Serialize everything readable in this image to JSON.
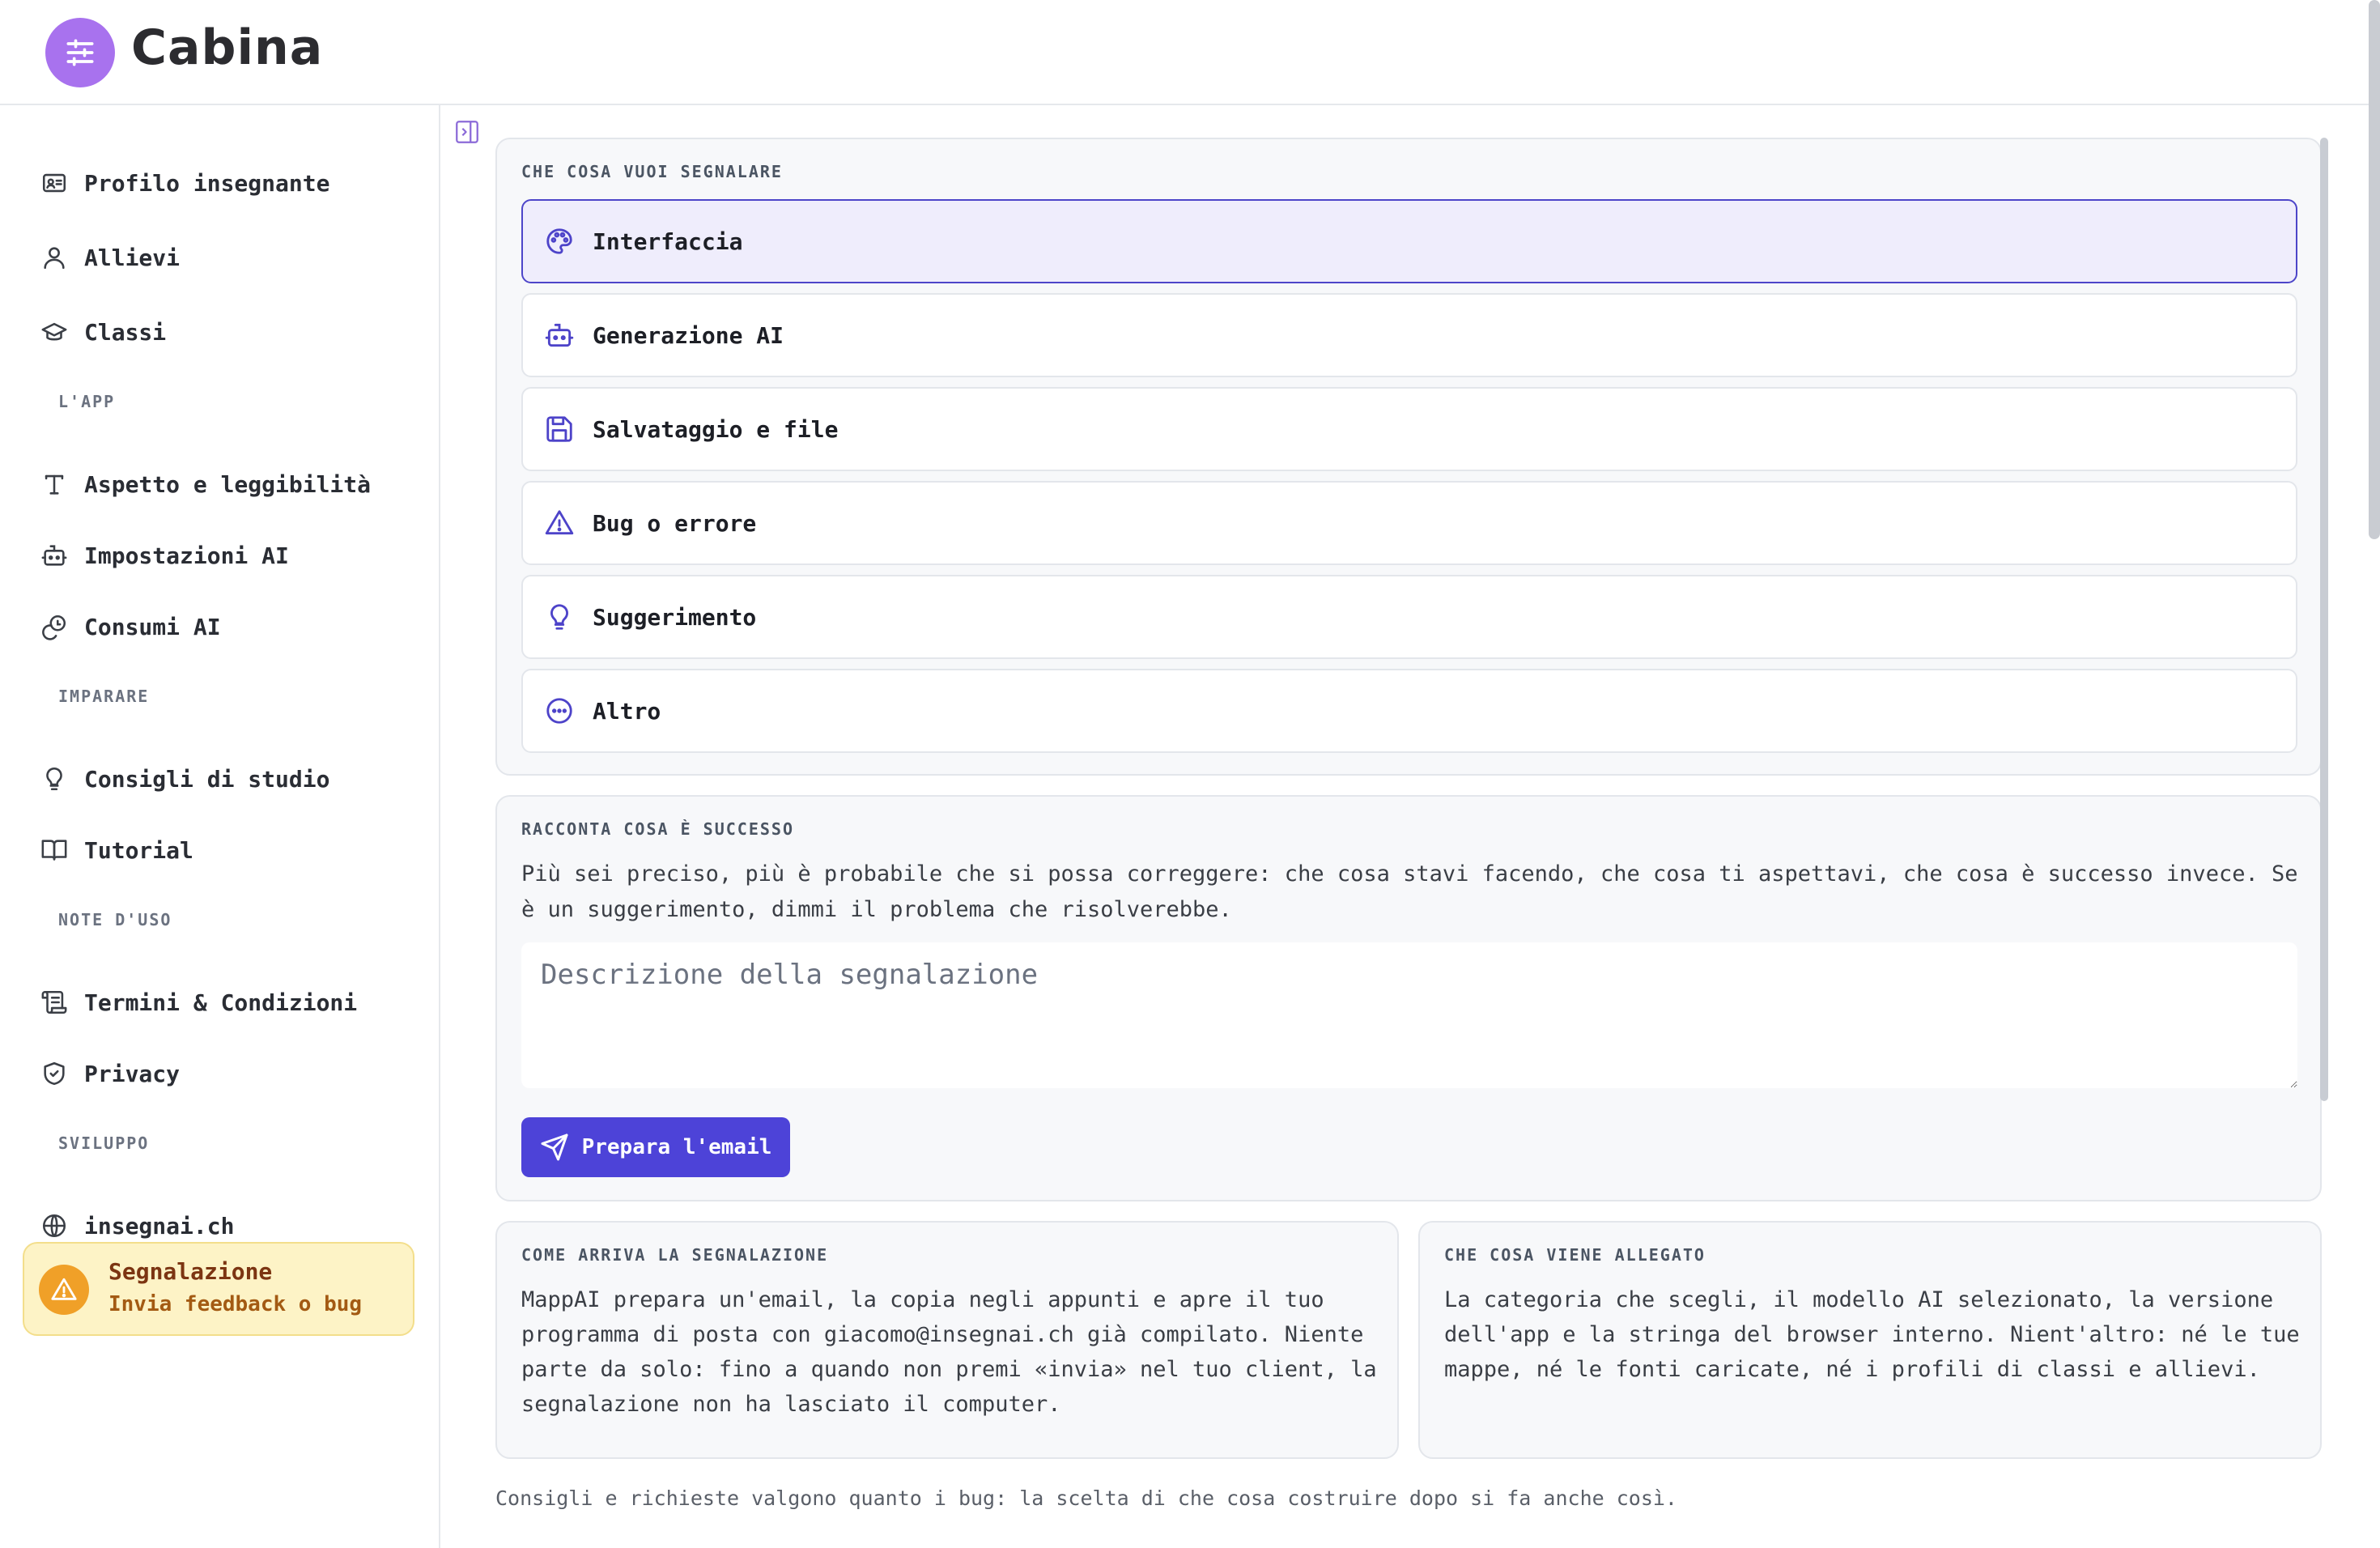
{
  "app": {
    "title": "Cabina"
  },
  "sidebar": {
    "items": [
      {
        "label": "Profilo insegnante",
        "icon": "id-card-icon"
      },
      {
        "label": "Allievi",
        "icon": "user-icon"
      },
      {
        "label": "Classi",
        "icon": "graduation-cap-icon"
      }
    ],
    "sections": [
      {
        "title": "L'APP",
        "items": [
          {
            "label": "Aspetto e leggibilità",
            "icon": "type-icon"
          },
          {
            "label": "Impostazioni AI",
            "icon": "bot-icon"
          },
          {
            "label": "Consumi AI",
            "icon": "coins-icon"
          }
        ]
      },
      {
        "title": "IMPARARE",
        "items": [
          {
            "label": "Consigli di studio",
            "icon": "lightbulb-icon"
          },
          {
            "label": "Tutorial",
            "icon": "book-open-icon"
          }
        ]
      },
      {
        "title": "NOTE D'USO",
        "items": [
          {
            "label": "Termini & Condizioni",
            "icon": "scroll-icon"
          },
          {
            "label": "Privacy",
            "icon": "shield-check-icon"
          }
        ]
      },
      {
        "title": "SVILUPPO",
        "items": [
          {
            "label": "insegnai.ch",
            "icon": "globe-icon"
          }
        ]
      }
    ],
    "active": {
      "title": "Segnalazione",
      "subtitle": "Invia feedback o bug",
      "icon": "warning-icon"
    }
  },
  "report": {
    "category_label": "CHE COSA VUOI SEGNALARE",
    "options": [
      {
        "label": "Interfaccia",
        "icon": "palette-icon",
        "selected": true
      },
      {
        "label": "Generazione AI",
        "icon": "bot-icon",
        "selected": false
      },
      {
        "label": "Salvataggio e file",
        "icon": "save-icon",
        "selected": false
      },
      {
        "label": "Bug o errore",
        "icon": "warning-icon",
        "selected": false
      },
      {
        "label": "Suggerimento",
        "icon": "lightbulb-icon",
        "selected": false
      },
      {
        "label": "Altro",
        "icon": "more-icon",
        "selected": false
      }
    ],
    "describe_label": "RACCONTA COSA È SUCCESSO",
    "describe_help": "Più sei preciso, più è probabile che si possa correggere: che cosa stavi facendo, che cosa ti aspettavi, che cosa è successo invece. Se è un suggerimento, dimmi il problema che risolverebbe.",
    "textarea_placeholder": "Descrizione della segnalazione",
    "textarea_value": "",
    "send_label": "Prepara l'email"
  },
  "info": {
    "how": {
      "title": "COME ARRIVA LA SEGNALAZIONE",
      "lines": [
        "MappAI prepara un'email, la copia negli appunti e apre il tuo",
        "programma di posta con giacomo@insegnai.ch già compilato. Niente",
        "parte da solo: fino a quando non premi «invia» nel tuo client, la",
        "segnalazione non ha lasciato il computer."
      ]
    },
    "attached": {
      "title": "CHE COSA VIENE ALLEGATO",
      "lines": [
        "La categoria che scegli, il modello AI selezionato, la versione",
        "dell'app e la stringa del browser interno. Nient'altro: né le tue",
        "mappe, né le fonti caricate, né i profili di classi e allievi."
      ]
    }
  },
  "footer_note": "Consigli e richieste valgono quanto i bug: la scelta di che cosa costruire dopo si fa anche così.",
  "colors": {
    "accent": "#4d43d8",
    "logo": "#a872ee",
    "selected_bg": "#efedfc",
    "active_bg": "#fdf3c6",
    "warning": "#f0a028"
  }
}
